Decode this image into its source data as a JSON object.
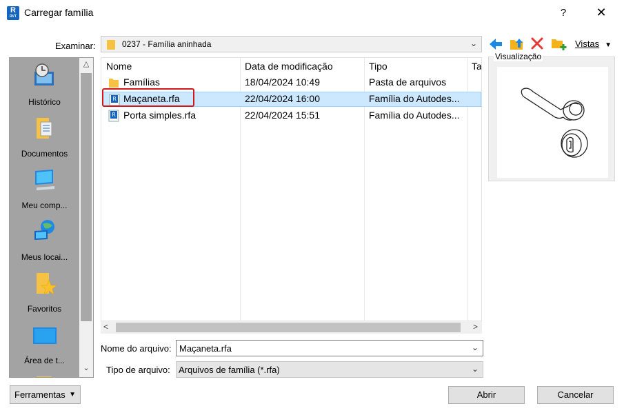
{
  "window": {
    "title": "Carregar família",
    "help": "?",
    "close": "✕"
  },
  "look_in": {
    "label": "Examinar:",
    "value": "0237 - Família aninhada"
  },
  "toolbar": {
    "views_label": "Vistas",
    "icons": [
      "back-arrow-icon",
      "up-folder-icon",
      "delete-icon",
      "new-folder-icon"
    ]
  },
  "places": [
    {
      "label": "Histórico",
      "icon": "history-icon"
    },
    {
      "label": "Documentos",
      "icon": "documents-icon"
    },
    {
      "label": "Meu comp...",
      "icon": "computer-icon"
    },
    {
      "label": "Meus locai...",
      "icon": "network-icon"
    },
    {
      "label": "Favoritos",
      "icon": "favorites-icon"
    },
    {
      "label": "Área de t...",
      "icon": "desktop-icon"
    }
  ],
  "file_list": {
    "columns": [
      "Nome",
      "Data de modificação",
      "Tipo",
      "Ta"
    ],
    "rows": [
      {
        "name": "Famílias",
        "date": "18/04/2024 10:49",
        "type": "Pasta de arquivos",
        "icon": "folder-icon",
        "selected": false
      },
      {
        "name": "Maçaneta.rfa",
        "date": "22/04/2024 16:00",
        "type": "Família do Autodes...",
        "icon": "rfa-file-icon",
        "selected": true
      },
      {
        "name": "Porta simples.rfa",
        "date": "22/04/2024 15:51",
        "type": "Família do Autodes...",
        "icon": "rfa-file-icon",
        "selected": false
      }
    ]
  },
  "preview": {
    "label": "Visualização"
  },
  "filename": {
    "label": "Nome do arquivo:",
    "value": "Maçaneta.rfa"
  },
  "filetype": {
    "label": "Tipo de arquivo:",
    "value": "Arquivos de família  (*.rfa)"
  },
  "buttons": {
    "tools": "Ferramentas",
    "open": "Abrir",
    "cancel": "Cancelar"
  },
  "colors": {
    "selection": "#cce8ff",
    "highlight_box": "#d0171c",
    "revit_blue": "#1565c0"
  }
}
